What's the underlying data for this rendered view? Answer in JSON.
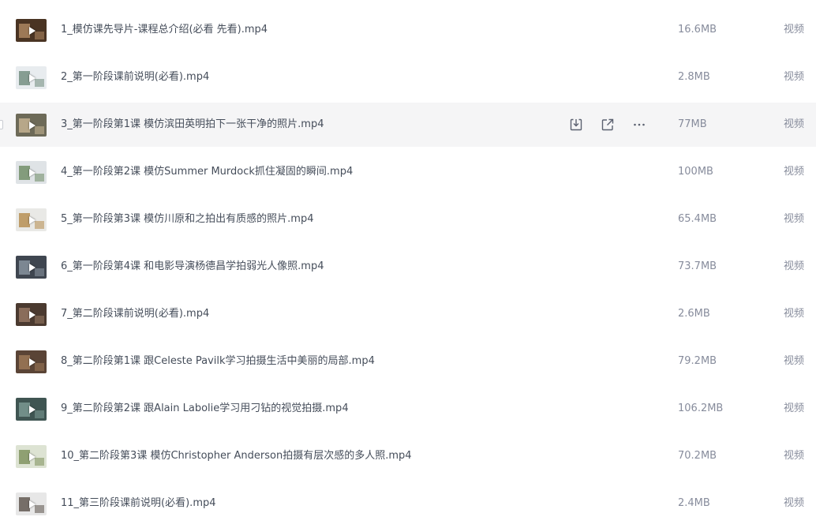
{
  "files": [
    {
      "name": "1_模仿课先导片-课程总介绍(必看 先看).mp4",
      "size": "16.6MB",
      "type": "视频",
      "thumb": {
        "bg": "#4a3423",
        "accent": "#b28b64"
      }
    },
    {
      "name": "2_第一阶段课前说明(必看).mp4",
      "size": "2.8MB",
      "type": "视频",
      "thumb": {
        "bg": "#e8ecef",
        "accent": "#6d8a7a"
      }
    },
    {
      "name": "3_第一阶段第1课 模仿滨田英明拍下一张干净的照片.mp4",
      "size": "77MB",
      "type": "视频",
      "thumb": {
        "bg": "#6d6a58",
        "accent": "#c9b796"
      },
      "hovered": true
    },
    {
      "name": "4_第一阶段第2课 模仿Summer Murdock抓住凝固的瞬间.mp4",
      "size": "100MB",
      "type": "视频",
      "thumb": {
        "bg": "#dfe3e6",
        "accent": "#6c8a62"
      }
    },
    {
      "name": "5_第一阶段第3课 模仿川原和之拍出有质感的照片.mp4",
      "size": "65.4MB",
      "type": "视频",
      "thumb": {
        "bg": "#e9e9e6",
        "accent": "#b48a4a"
      }
    },
    {
      "name": "6_第一阶段第4课 和电影导演杨德昌学拍弱光人像照.mp4",
      "size": "73.7MB",
      "type": "视频",
      "thumb": {
        "bg": "#3f4650",
        "accent": "#8c97a2"
      }
    },
    {
      "name": "7_第二阶段课前说明(必看).mp4",
      "size": "2.6MB",
      "type": "视频",
      "thumb": {
        "bg": "#4b3a30",
        "accent": "#9a7b66"
      }
    },
    {
      "name": "8_第二阶段第1课 跟Celeste Pavilk学习拍摄生活中美丽的局部.mp4",
      "size": "79.2MB",
      "type": "视频",
      "thumb": {
        "bg": "#5a4436",
        "accent": "#a07c5a"
      }
    },
    {
      "name": "9_第二阶段第2课 跟Alain Labolie学习用刁钻的视觉拍摄.mp4",
      "size": "106.2MB",
      "type": "视频",
      "thumb": {
        "bg": "#3f5552",
        "accent": "#7e9c96"
      }
    },
    {
      "name": "10_第二阶段第3课 模仿Christopher Anderson拍摄有层次感的多人照.mp4",
      "size": "70.2MB",
      "type": "视频",
      "thumb": {
        "bg": "#dde3d3",
        "accent": "#7c8f5a"
      }
    },
    {
      "name": "11_第三阶段课前说明(必看).mp4",
      "size": "2.4MB",
      "type": "视频",
      "thumb": {
        "bg": "#e7e7e7",
        "accent": "#5a5048"
      }
    }
  ],
  "row_actions": [
    {
      "name": "download-icon"
    },
    {
      "name": "share-icon"
    },
    {
      "name": "more-icon"
    }
  ]
}
